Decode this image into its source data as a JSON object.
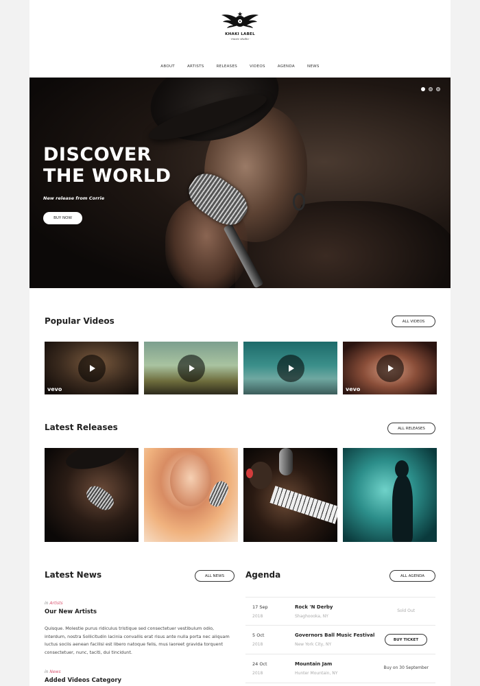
{
  "header": {
    "logo_name": "KHAKI LABEL",
    "logo_tagline": "· music studio ·",
    "nav": [
      "ABOUT",
      "ARTISTS",
      "RELEASES",
      "VIDEOS",
      "AGENDA",
      "NEWS"
    ]
  },
  "hero": {
    "title_line1": "DISCOVER",
    "title_line2": "THE WORLD",
    "subtitle": "New release from Corrie",
    "button": "BUY NOW",
    "slider_dots": 3,
    "active_dot": 1
  },
  "videos": {
    "title": "Popular Videos",
    "button": "ALL VIDEOS",
    "items": [
      {
        "badge": "vevo"
      },
      {
        "badge": ""
      },
      {
        "badge": ""
      },
      {
        "badge": "vevo"
      }
    ]
  },
  "releases": {
    "title": "Latest Releases",
    "button": "ALL RELEASES"
  },
  "news": {
    "title": "Latest News",
    "button": "ALL NEWS",
    "posts": [
      {
        "prefix": "in",
        "category": "Artists",
        "title": "Our New Artists",
        "excerpt": "Quisque. Molestie purus ridiculus tristique sed consectetuer vestibulum odio, interdum, nostra Sollicitudin lacinia convallis erat risus ante nulla porta nec aliquam luctus sociis aenean facilisi est libero natoque felis, mus laoreet gravida torquent consectetuer, nunc, taciti, dui tincidunt."
      },
      {
        "prefix": "in",
        "category": "News",
        "title": "Added Videos Category"
      }
    ]
  },
  "agenda": {
    "title": "Agenda",
    "button": "ALL AGENDA",
    "events": [
      {
        "date": "17 Sep",
        "year": "2018",
        "name": "Rock 'N Derby",
        "place": "Shaghoooka, NY",
        "status": "Sold Out"
      },
      {
        "date": "5 Oct",
        "year": "2018",
        "name": "Governors Ball Music Festival",
        "place": "New York City, NY",
        "action": "BUY TICKET"
      },
      {
        "date": "24 Oct",
        "year": "2018",
        "name": "Mountain Jam",
        "place": "Hunter Mountain, NY",
        "status": "Buy on 30 September"
      }
    ]
  }
}
